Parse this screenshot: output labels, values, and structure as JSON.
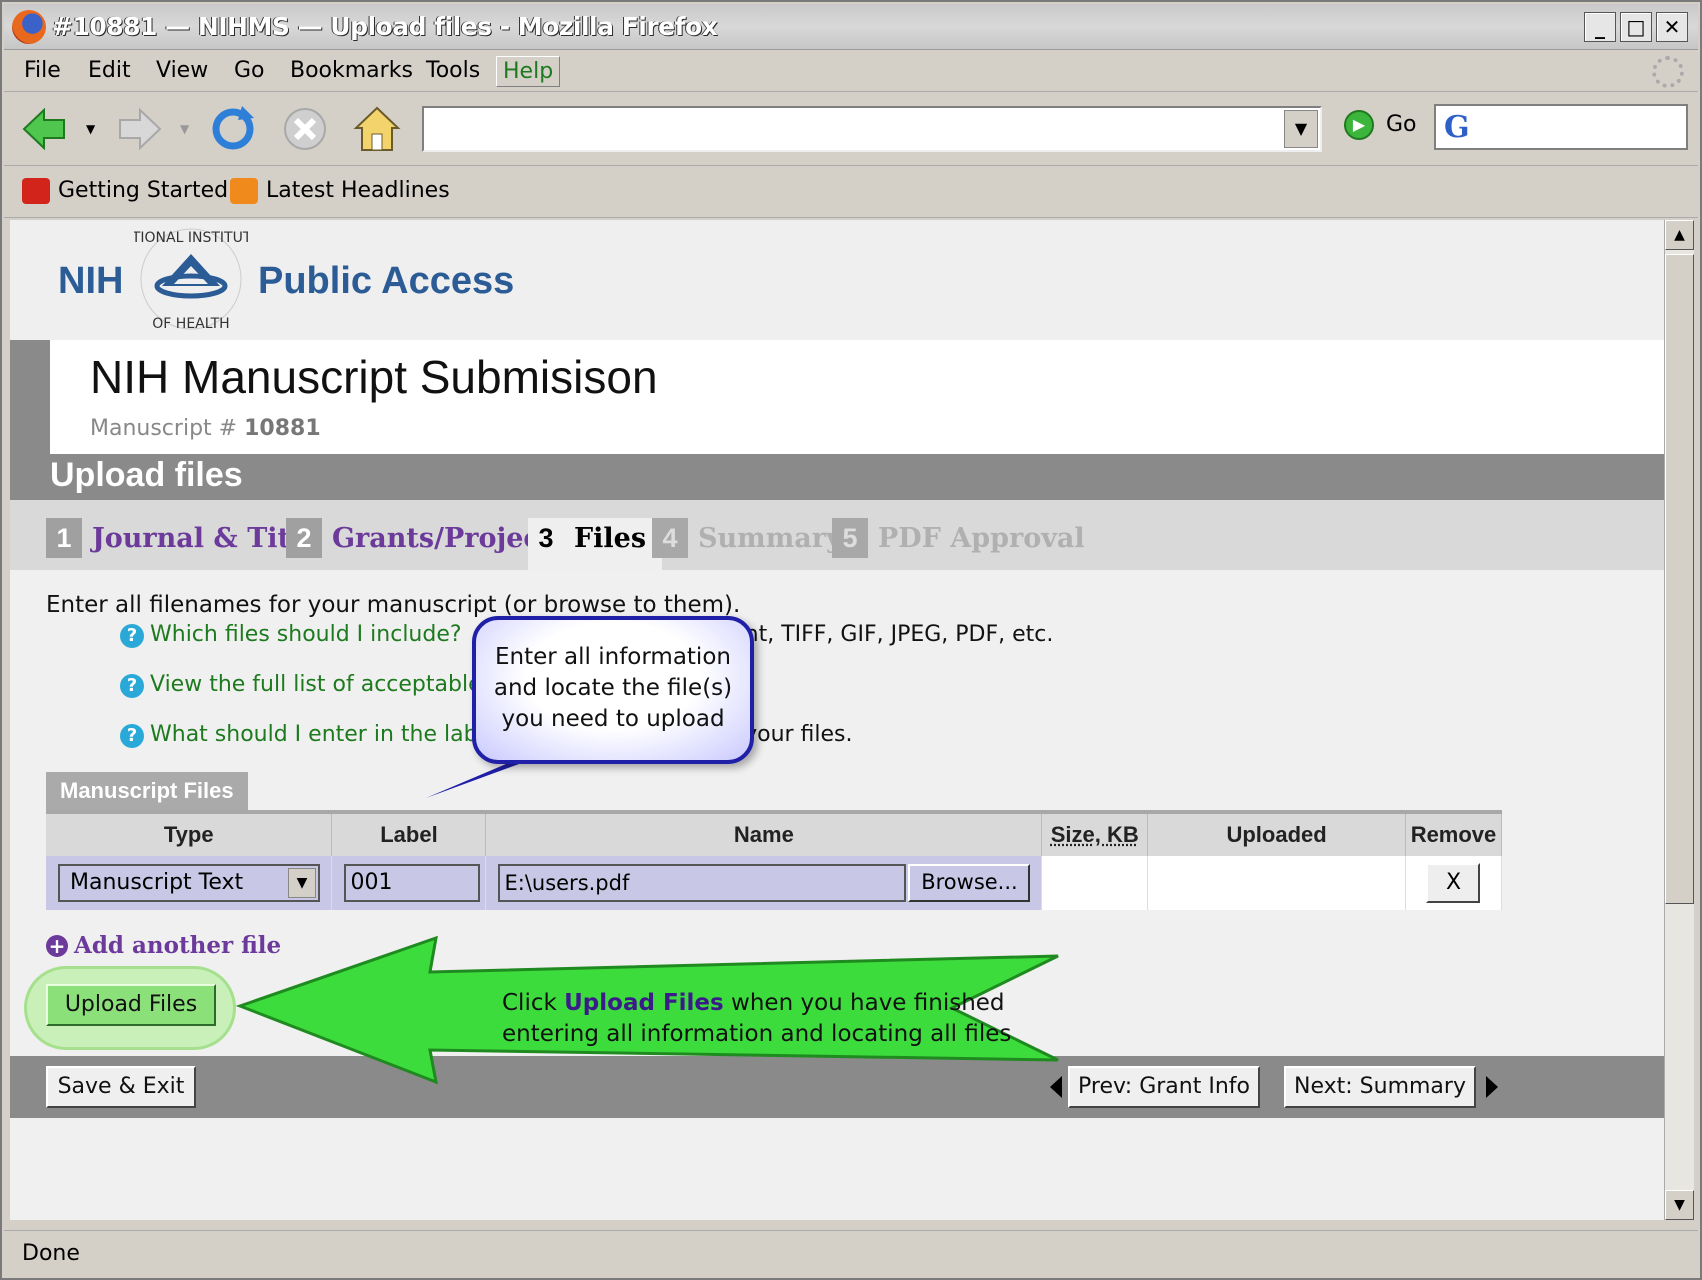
{
  "window": {
    "title": "#10881 — NIHMS — Upload files - Mozilla Firefox"
  },
  "menus": [
    "File",
    "Edit",
    "View",
    "Go",
    "Bookmarks",
    "Tools",
    "Help"
  ],
  "nav": {
    "url": "",
    "go_label": "Go",
    "search_logo": "G"
  },
  "bookmarks": [
    "Getting Started",
    "Latest Headlines"
  ],
  "header": {
    "nih": "NIH",
    "public_access": "Public Access"
  },
  "page": {
    "title": "NIH Manuscript Submisison",
    "manuscript_label": "Manuscript #",
    "manuscript_no": "10881",
    "section": "Upload files"
  },
  "steps": [
    {
      "n": "1",
      "label": "Journal & Title"
    },
    {
      "n": "2",
      "label": "Grants/Projects"
    },
    {
      "n": "3",
      "label": "Files"
    },
    {
      "n": "4",
      "label": "Summary"
    },
    {
      "n": "5",
      "label": "PDF Approval"
    }
  ],
  "intro": "Enter all filenames for your manuscript (or browse to them).",
  "help_links": [
    {
      "link": "Which files should I include?",
      "rest": "erPoint, TIFF, GIF, JPEG, PDF, etc."
    },
    {
      "link": "View the full list of acceptable",
      "rest": ""
    },
    {
      "link": "What should I enter in the lab",
      "rest": "abel your files."
    }
  ],
  "files": {
    "heading": "Manuscript Files",
    "columns": [
      "Type",
      "Label",
      "Name",
      "Size, KB",
      "Uploaded",
      "Remove"
    ],
    "row": {
      "type": "Manuscript Text",
      "label": "001",
      "name": "E:\\users.pdf",
      "browse": "Browse...",
      "size": "",
      "uploaded": "",
      "remove": "X"
    }
  },
  "add_file": "Add another file",
  "upload_button": "Upload Files",
  "bottom": {
    "save_exit": "Save & Exit",
    "prev": "Prev: Grant Info",
    "next": "Next: Summary"
  },
  "callout": {
    "line1": "Enter all information",
    "line2": "and locate the file(s)",
    "line3": "you need to upload"
  },
  "arrow": {
    "pre": "Click ",
    "bold": "Upload Files",
    "post1": " when you have finished",
    "line2": "entering all information and locating all files"
  },
  "status": "Done",
  "colors": {
    "nih_blue": "#2b5c96",
    "link_purple": "#6b3a9a",
    "help_green": "#1e7a1e",
    "arrow_green": "#3ddc3d",
    "callout_border": "#1f1fa8"
  }
}
